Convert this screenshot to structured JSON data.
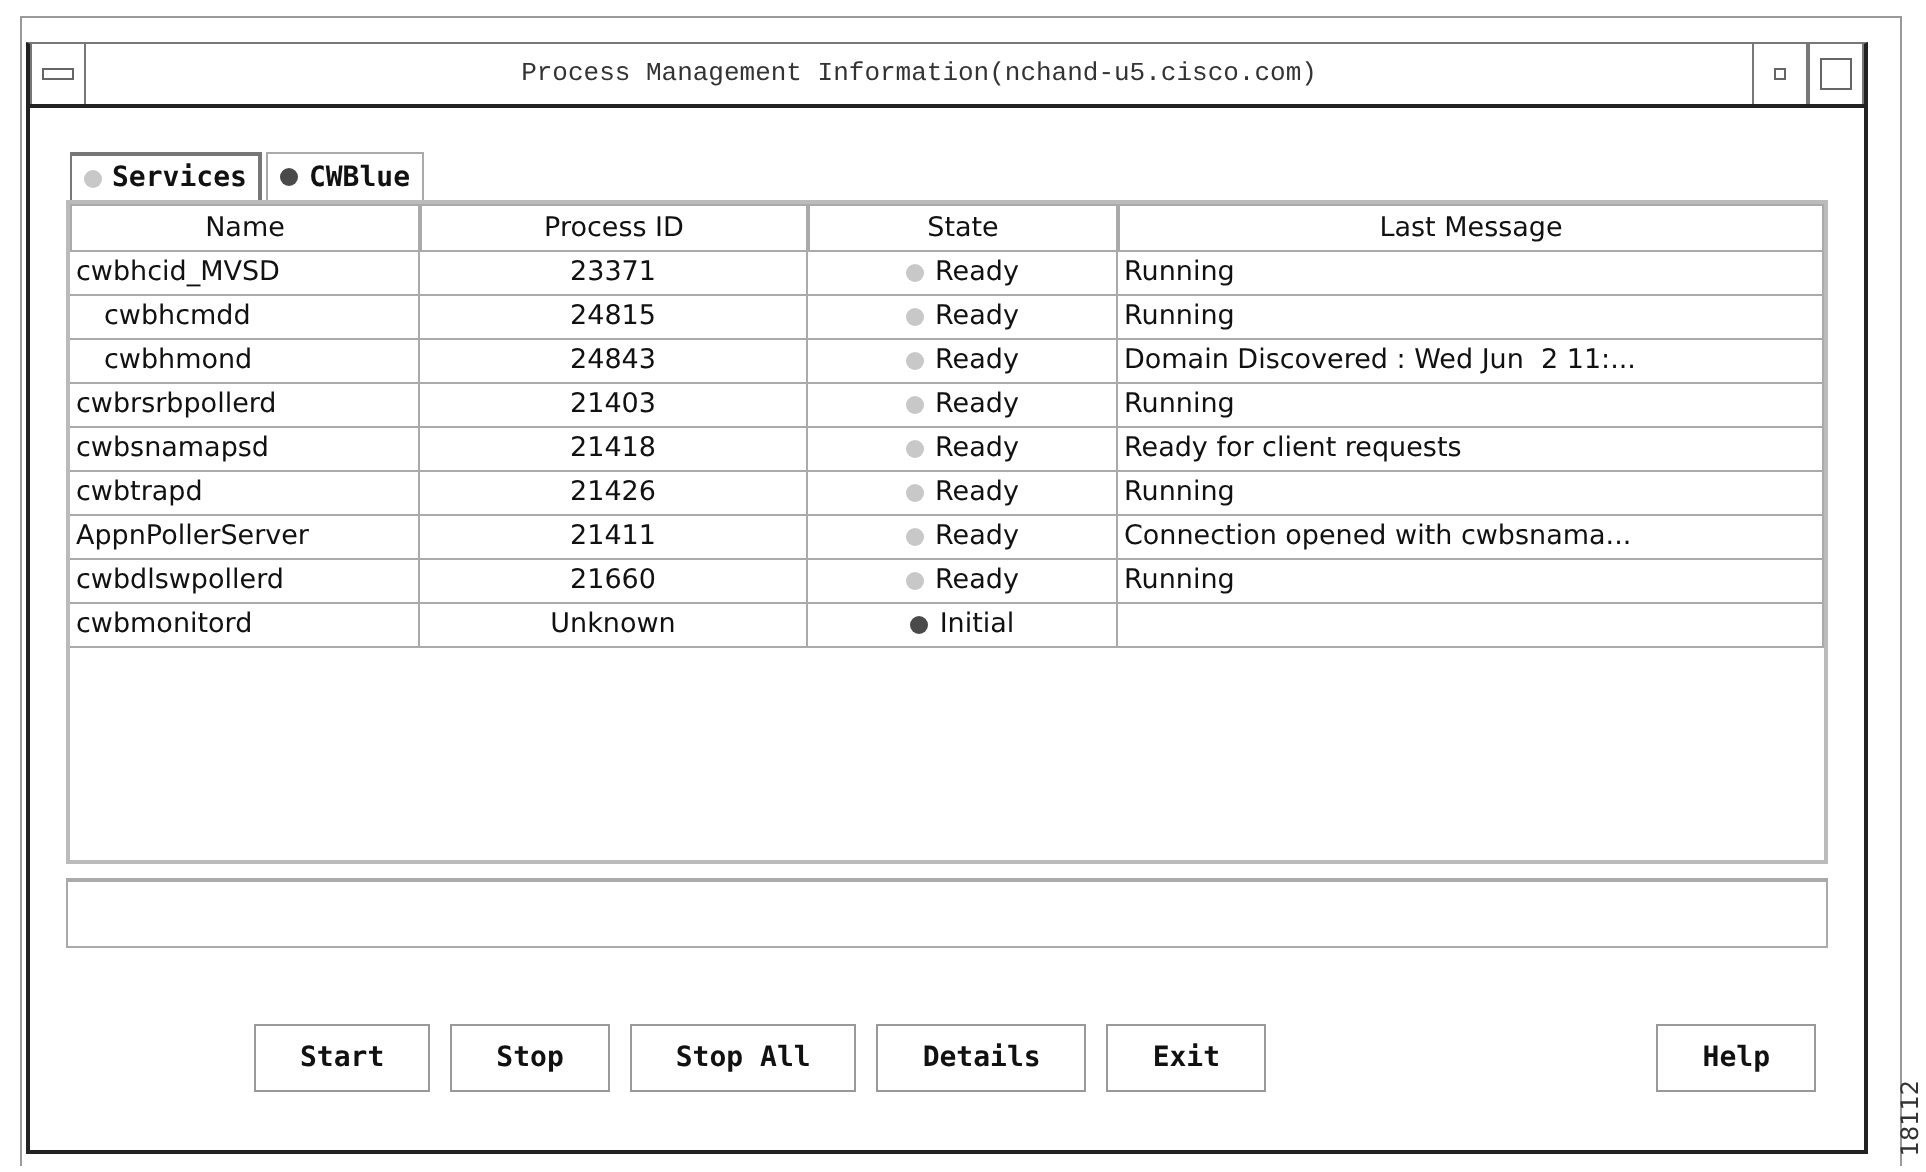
{
  "window": {
    "title": "Process Management Information(nchand-u5.cisco.com)"
  },
  "tabs": [
    {
      "label": "Services",
      "selected": true,
      "color": "#c8c8c8"
    },
    {
      "label": "CWBlue",
      "selected": false,
      "color": "#4a4a4a"
    }
  ],
  "table": {
    "columns": [
      "Name",
      "Process ID",
      "State",
      "Last Message"
    ],
    "rows": [
      {
        "name": "cwbhcid_MVSD",
        "process_id": "23371",
        "state": "Ready",
        "color": "#c8c8c8",
        "last_message": "Running",
        "children": [
          {
            "name": "cwbhcmdd",
            "process_id": "24815",
            "state": "Ready",
            "color": "#c8c8c8",
            "last_message": "Running"
          },
          {
            "name": "cwbhmond",
            "process_id": "24843",
            "state": "Ready",
            "color": "#c8c8c8",
            "last_message": "Domain Discovered : Wed Jun  2 11:..."
          }
        ]
      },
      {
        "name": "cwbrsrbpollerd",
        "process_id": "21403",
        "state": "Ready",
        "color": "#c8c8c8",
        "last_message": "Running"
      },
      {
        "name": "cwbsnamapsd",
        "process_id": "21418",
        "state": "Ready",
        "color": "#c8c8c8",
        "last_message": "Ready for client requests"
      },
      {
        "name": "cwbtrapd",
        "process_id": "21426",
        "state": "Ready",
        "color": "#c8c8c8",
        "last_message": "Running"
      },
      {
        "name": "AppnPollerServer",
        "process_id": "21411",
        "state": "Ready",
        "color": "#c8c8c8",
        "last_message": "Connection opened with cwbsnama..."
      },
      {
        "name": "cwbdlswpollerd",
        "process_id": "21660",
        "state": "Ready",
        "color": "#c8c8c8",
        "last_message": "Running"
      },
      {
        "name": "cwbmonitord",
        "process_id": "Unknown",
        "state": "Initial",
        "color": "#4a4a4a"
      }
    ]
  },
  "buttons": [
    {
      "label": "Start"
    },
    {
      "label": "Stop"
    },
    {
      "label": "Stop All"
    },
    {
      "label": "Details"
    },
    {
      "label": "Exit"
    },
    {
      "label": "Help",
      "kind": "help"
    }
  ],
  "figure_number": "18112"
}
